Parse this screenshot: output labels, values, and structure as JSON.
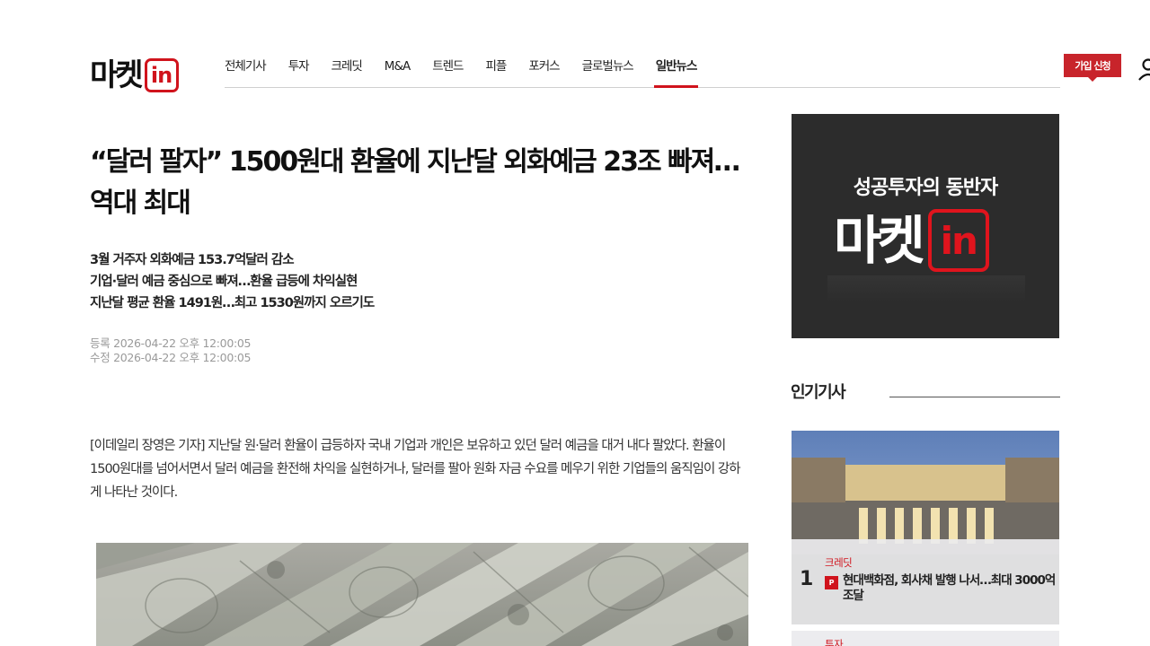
{
  "header": {
    "logo_text": "마켓",
    "logo_badge": "in",
    "nav": [
      {
        "label": "전체기사"
      },
      {
        "label": "투자"
      },
      {
        "label": "크레딧"
      },
      {
        "label": "M&A"
      },
      {
        "label": "트렌드"
      },
      {
        "label": "피플"
      },
      {
        "label": "포커스"
      },
      {
        "label": "글로벌뉴스"
      },
      {
        "label": "일반뉴스",
        "active": true
      }
    ],
    "join_label": "가입 신청",
    "user_icon": "user-icon",
    "search_icon": "search-icon"
  },
  "article": {
    "title": "“달러 팔자” 1500원대 환율에 지난달 외화예금 23조 빠져…역대 최대",
    "subtitles": [
      "3월 거주자 외화예금 153.7억달러 감소",
      "기업·달러 예금 중심으로 빠져…환율 급등에 차익실현",
      "지난달 평균 환율 1491원…최고 1530원까지 오르기도"
    ],
    "registered": "등록 2026-04-22 오후 12:00:05",
    "modified": "수정 2026-04-22 오후 12:00:05",
    "body": "[이데일리 장영은 기자] 지난달 원·달러 환율이 급등하자 국내 기업과 개인은 보유하고 있던 달러 예금을 대거 내다 팔았다. 환율이 1500원대를 넘어서면서 달러 예금을 환전해 차익을 실현하거나, 달러를 팔아 원화 자금 수요를 메우기 위한 기업들의 움직임이 강하게 나타난 것이다."
  },
  "sidebar": {
    "ad": {
      "slogan": "성공투자의 동반자",
      "logo_text": "마켓",
      "logo_badge": "in"
    },
    "popular_title": "인기기사",
    "popular": [
      {
        "rank": "1",
        "category": "크레딧",
        "badge": "P",
        "headline": "현대백화점, 회사채 발행 나서…최대 3000억 조달"
      },
      {
        "category": "투자"
      }
    ]
  },
  "colors": {
    "accent": "#d0131c",
    "join_button": "#c8242b",
    "ad_background": "#2c2c2c"
  }
}
